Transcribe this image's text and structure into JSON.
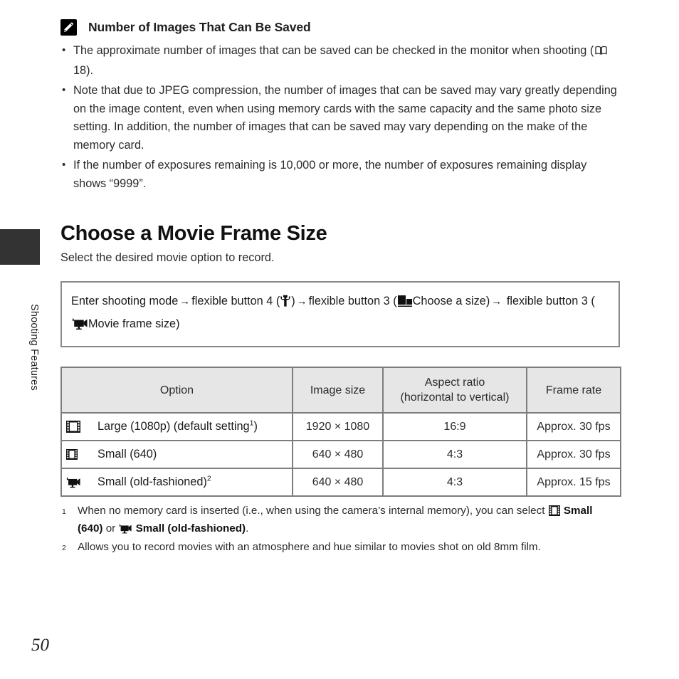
{
  "sidebar": {
    "tab_label": "Shooting Features",
    "tab_color": "#333333"
  },
  "page_number": "50",
  "note": {
    "icon": "pencil-note-icon",
    "title": "Number of Images That Can Be Saved",
    "bullets": [
      {
        "text_before": "The approximate number of images that can be saved can be checked in the monitor when shooting (",
        "reference_icon": "open-book-icon",
        "reference": "18",
        "text_after": ")."
      },
      {
        "text_before": "Note that due to JPEG compression, the number of images that can be saved may vary greatly depending on the image content, even when using memory cards with the same capacity and the same photo size setting. In addition, the number of images that can be saved may vary depending on the make of the memory card.",
        "reference_icon": "",
        "reference": "",
        "text_after": ""
      },
      {
        "text_before": "If the number of exposures remaining is 10,000 or more, the number of exposures remaining display shows “9999”.",
        "reference_icon": "",
        "reference": "",
        "text_after": ""
      }
    ]
  },
  "section": {
    "title": "Choose a Movie Frame Size",
    "subtitle": "Select the desired movie option to record."
  },
  "path_box": {
    "arrow": "→",
    "segment1": "Enter shooting mode",
    "segment2_pre": "flexible button 4 (",
    "segment2_icon": "wrench-icon",
    "segment2_post": ")",
    "segment3_pre": "flexible button 3 (",
    "segment3_icon": "image-size-icon",
    "segment3_label": "Choose a size",
    "segment3_post": ")",
    "segment4_pre": "flexible button 3 (",
    "segment4_icon": "movie-camera-icon",
    "segment4_label": "Movie frame size",
    "segment4_post": ")"
  },
  "table": {
    "headers": [
      "Option",
      "Image size",
      "Aspect ratio\n(horizontal to vertical)"
    ],
    "header_aspect_line1": "Aspect ratio",
    "header_aspect_line2": "(horizontal to vertical)",
    "header_option": "Option",
    "header_image_size": "Image size",
    "header_frame_rate": "Frame rate",
    "rows": [
      {
        "icon": "film-frame-large-icon",
        "option": "Large (1080p) (default setting",
        "option_sup": "1",
        "option_tail": ")",
        "image_size": "1920 × 1080",
        "aspect_ratio": "16:9",
        "frame_rate": "Approx. 30 fps"
      },
      {
        "icon": "film-frame-small-icon",
        "option": "Small (640)",
        "option_sup": "",
        "option_tail": "",
        "image_size": "640 × 480",
        "aspect_ratio": "4:3",
        "frame_rate": "Approx. 30 fps"
      },
      {
        "icon": "movie-camera-old-icon",
        "option": "Small (old-fashioned)",
        "option_sup": "2",
        "option_tail": "",
        "image_size": "640 × 480",
        "aspect_ratio": "4:3",
        "frame_rate": "Approx. 15 fps"
      }
    ]
  },
  "footnotes": [
    {
      "marker": "1",
      "part1": "When no memory card is inserted (i.e., when using the camera’s internal memory), you can select ",
      "bold1": "Small (640)",
      "mid": " or ",
      "bold2": "Small (old-fashioned)",
      "part2": "."
    },
    {
      "marker": "2",
      "part1": "Allows you to record movies with an atmosphere and hue similar to movies shot on old 8mm film.",
      "bold1": "",
      "mid": "",
      "bold2": "",
      "part2": ""
    }
  ]
}
